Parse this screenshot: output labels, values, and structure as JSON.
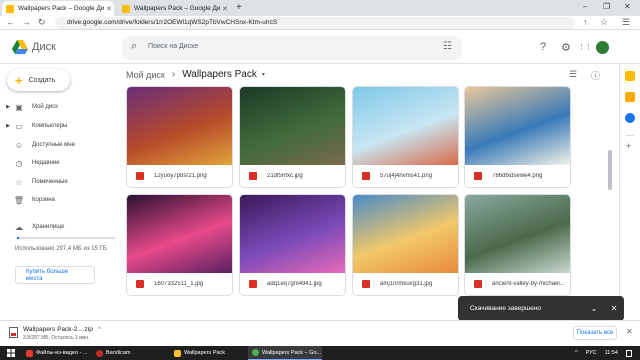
{
  "browser": {
    "tabs": [
      {
        "title": "Wallpapers Pack – Google Диск",
        "active": true,
        "favicon_color": "#fbbc04"
      },
      {
        "title": "Wallpapers Pack – Google Диск",
        "active": false,
        "favicon_color": "#fbbc04"
      }
    ],
    "new_tab": "+",
    "window": {
      "minimize": "–",
      "maximize": "❐",
      "close": "✕"
    },
    "url": "drive.google.com/drive/folders/1rr2OEWl1qWS2pTbVwCHSnx-Ktm-uIrcS",
    "nav": {
      "back": "←",
      "forward": "→",
      "reload": "↻"
    },
    "toolbar_icons": [
      "↑",
      "☆",
      "☰"
    ]
  },
  "drive": {
    "brand": "Диск",
    "search_placeholder": "Поиск на Диске",
    "header_icons": {
      "help": "?",
      "settings": "⚙",
      "apps": "⋮⋮"
    },
    "create_label": "Создать",
    "nav": [
      {
        "label": "Мой диск",
        "icon": "drive-icon",
        "glyph": "▣",
        "expandable": true
      },
      {
        "label": "Компьютеры",
        "icon": "computer-icon",
        "glyph": "▭",
        "expandable": true
      },
      {
        "label": "Доступные мне",
        "icon": "people-icon",
        "glyph": "☺",
        "expandable": false
      },
      {
        "label": "Недавние",
        "icon": "clock-icon",
        "glyph": "◷",
        "expandable": false
      },
      {
        "label": "Помеченные",
        "icon": "star-icon",
        "glyph": "☆",
        "expandable": false
      },
      {
        "label": "Корзина",
        "icon": "trash-icon",
        "glyph": "🗑",
        "expandable": false
      }
    ],
    "storage": {
      "label": "Хранилище",
      "usage_text": "Использовано 297,4 МБ из 15 ГБ",
      "used_fraction": 0.02,
      "buy_label": "Купить больше места"
    },
    "breadcrumb": {
      "root": "Мой диск",
      "separator": "›",
      "current": "Wallpapers Pack",
      "dropdown": "▾"
    },
    "view_icons": {
      "list": "☰",
      "info": "ⓘ"
    },
    "files": [
      {
        "name": "12yuoy7p8sr21.png",
        "colors": [
          "#6a2e7a",
          "#b64a2a",
          "#e0a43a"
        ]
      },
      {
        "name": "21df5hfxc.jpg",
        "colors": [
          "#1d3a26",
          "#3f6b3a",
          "#7a6a4a"
        ]
      },
      {
        "name": "57uj4j4nvms41.png",
        "colors": [
          "#7ec8e8",
          "#c8e6f2",
          "#d86a4a"
        ]
      },
      {
        "name": "786dfxdsewe4.png",
        "colors": [
          "#e8c89a",
          "#3a7ab8",
          "#f2f2ea"
        ]
      },
      {
        "name": "1607332511_1.jpg",
        "colors": [
          "#2a1030",
          "#e84a8a",
          "#5a2060"
        ]
      },
      {
        "name": "adq1eq7gm4941.jpg",
        "colors": [
          "#3a1a5a",
          "#7a4ab8",
          "#e86ab8"
        ]
      },
      {
        "name": "amj1nrmkuvg31.jpg",
        "colors": [
          "#4a8ac8",
          "#f2c86a",
          "#e88a3a"
        ]
      },
      {
        "name": "ancient-valley-by-michael...",
        "colors": [
          "#8aa8a0",
          "#4a6a4a",
          "#c8d8d0"
        ]
      }
    ],
    "toast": {
      "text": "Скачивание завершено",
      "expand": "⌄",
      "close": "✕"
    }
  },
  "downloads": {
    "file_name": "Wallpapers Pack-2....zip",
    "status": "3,8/287 МБ, Осталось 3 мин.",
    "caret": "^",
    "show_all_label": "Показать все",
    "close": "✕"
  },
  "taskbar": {
    "items": [
      {
        "label": "Файлы-из-видео - ...",
        "color": "#e53935"
      },
      {
        "label": "Bandicam",
        "color": "#c62828"
      },
      {
        "label": "Wallpapers Pack",
        "color": "#fbc02d"
      },
      {
        "label": "Wallpapers Pack – Go...",
        "color": "#4caf50"
      }
    ],
    "lang": "РУС",
    "time": "11:54",
    "tray_arrow": "^"
  }
}
